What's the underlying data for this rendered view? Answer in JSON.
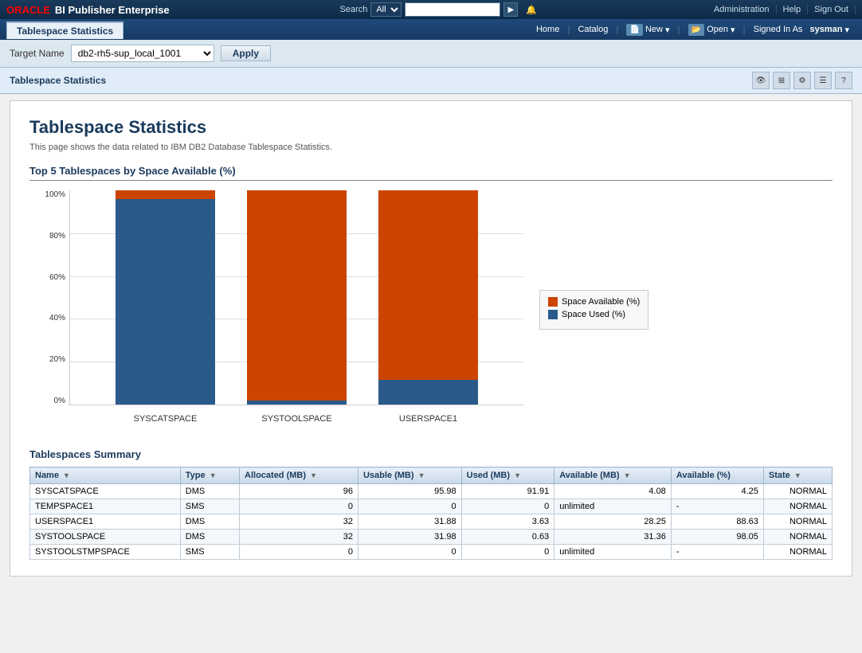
{
  "topNav": {
    "oracleLabel": "ORACLE",
    "biPublisherLabel": "BI Publisher Enterprise",
    "searchLabel": "Search",
    "searchOption": "All",
    "searchPlaceholder": "",
    "adminLabel": "Administration",
    "helpLabel": "Help",
    "signOutLabel": "Sign Out"
  },
  "secondNav": {
    "pageTabLabel": "Tablespace Statistics",
    "homeLabel": "Home",
    "catalogLabel": "Catalog",
    "newLabel": "New",
    "openLabel": "Open",
    "signedInAs": "Signed In As",
    "username": "sysman"
  },
  "toolbar": {
    "targetLabel": "Target Name",
    "targetValue": "db2-rh5-sup_local_1001",
    "applyLabel": "Apply"
  },
  "reportHeader": {
    "tabLabel": "Tablespace Statistics"
  },
  "report": {
    "title": "Tablespace Statistics",
    "description": "This page shows the data related to IBM DB2 Database Tablespace Statistics.",
    "chartHeading": "Top 5 Tablespaces by Space Available (%)",
    "legend": {
      "available": "Space Available (%)",
      "used": "Space Used (%)"
    },
    "bars": [
      {
        "name": "SYSCATSPACE",
        "available": 4.25,
        "used": 95.75
      },
      {
        "name": "SYSTOOLSPACE",
        "available": 98.05,
        "used": 1.95
      },
      {
        "name": "USERSPACE1",
        "available": 88.63,
        "used": 11.37
      }
    ],
    "yLabels": [
      "100%",
      "80%",
      "60%",
      "40%",
      "20%",
      "0%"
    ],
    "tableHeading": "Tablespaces Summary",
    "tableColumns": [
      "Name",
      "Type",
      "Allocated (MB)",
      "Usable (MB)",
      "Used (MB)",
      "Available (MB)",
      "Available (%)",
      "State"
    ],
    "tableRows": [
      {
        "name": "SYSCATSPACE",
        "type": "DMS",
        "allocated": "96",
        "usable": "95.98",
        "used": "91.91",
        "available": "4.08",
        "availPct": "4.25",
        "state": "NORMAL"
      },
      {
        "name": "TEMPSPACE1",
        "type": "SMS",
        "allocated": "0",
        "usable": "0",
        "used": "0",
        "available": "unlimited",
        "availPct": "-",
        "state": "NORMAL"
      },
      {
        "name": "USERSPACE1",
        "type": "DMS",
        "allocated": "32",
        "usable": "31.88",
        "used": "3.63",
        "available": "28.25",
        "availPct": "88.63",
        "state": "NORMAL"
      },
      {
        "name": "SYSTOOLSPACE",
        "type": "DMS",
        "allocated": "32",
        "usable": "31.98",
        "used": "0.63",
        "available": "31.36",
        "availPct": "98.05",
        "state": "NORMAL"
      },
      {
        "name": "SYSTOOLSTMPSPACE",
        "type": "SMS",
        "allocated": "0",
        "usable": "0",
        "used": "0",
        "available": "unlimited",
        "availPct": "-",
        "state": "NORMAL"
      }
    ]
  }
}
